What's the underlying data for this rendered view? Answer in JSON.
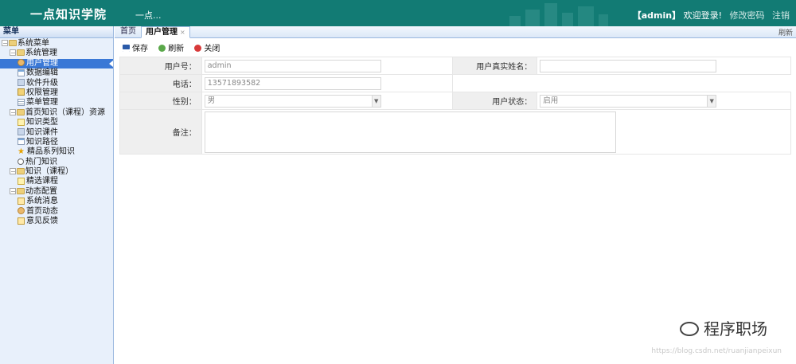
{
  "header": {
    "brand": "一点知识学院",
    "slogan": "一点...",
    "user": "【admin】",
    "welcome": "欢迎登录!",
    "change_password": "修改密码",
    "logout": "注销"
  },
  "sidebar": {
    "title": "菜单",
    "items": [
      {
        "label": "系统菜单",
        "level": 0,
        "type": "folder",
        "icon": "folder-icon"
      },
      {
        "label": "系统管理",
        "level": 1,
        "type": "folder",
        "icon": "folder-icon"
      },
      {
        "label": "用户管理",
        "level": 2,
        "type": "leaf",
        "icon": "user-icon",
        "selected": true
      },
      {
        "label": "数据编辑",
        "level": 2,
        "type": "leaf",
        "icon": "grid-icon"
      },
      {
        "label": "软件升级",
        "level": 2,
        "type": "leaf",
        "icon": "box-icon"
      },
      {
        "label": "权限管理",
        "level": 2,
        "type": "leaf",
        "icon": "lock-icon"
      },
      {
        "label": "菜单管理",
        "level": 2,
        "type": "leaf",
        "icon": "list-icon"
      },
      {
        "label": "首页知识（课程）资源",
        "level": 1,
        "type": "folder",
        "icon": "folder-icon"
      },
      {
        "label": "知识类型",
        "level": 2,
        "type": "leaf",
        "icon": "doc-icon"
      },
      {
        "label": "知识课件",
        "level": 2,
        "type": "leaf",
        "icon": "box-icon"
      },
      {
        "label": "知识路径",
        "level": 2,
        "type": "leaf",
        "icon": "grid-icon"
      },
      {
        "label": "精品系列知识",
        "level": 2,
        "type": "leaf",
        "icon": "star-icon"
      },
      {
        "label": "热门知识",
        "level": 2,
        "type": "leaf",
        "icon": "search-icon"
      },
      {
        "label": "知识（课程）",
        "level": 1,
        "type": "folder",
        "icon": "folder-icon"
      },
      {
        "label": "精选课程",
        "level": 2,
        "type": "leaf",
        "icon": "doc-icon"
      },
      {
        "label": "动态配置",
        "level": 1,
        "type": "folder",
        "icon": "folder-icon"
      },
      {
        "label": "系统消息",
        "level": 2,
        "type": "leaf",
        "icon": "mail-icon"
      },
      {
        "label": "首页动态",
        "level": 2,
        "type": "leaf",
        "icon": "user-icon"
      },
      {
        "label": "意见反馈",
        "level": 2,
        "type": "leaf",
        "icon": "mail-icon"
      }
    ]
  },
  "tabs": {
    "home": "首页",
    "active": "用户管理",
    "close": "×",
    "refresh": "刷新"
  },
  "toolbar": {
    "save": "保存",
    "refresh": "刷新",
    "close": "关闭"
  },
  "form": {
    "user_id_label": "用户号：",
    "user_id_value": "admin",
    "real_name_label": "用户真实姓名：",
    "real_name_value": "",
    "phone_label": "电话：",
    "phone_value": "13571893582",
    "gender_label": "性别：",
    "gender_value": "男",
    "status_label": "用户状态：",
    "status_value": "启用",
    "remark_label": "备注：",
    "remark_value": ""
  },
  "watermark": {
    "main": "程序职场",
    "url": "https://blog.csdn.net/ruanjianpeixun"
  },
  "colors": {
    "header_bg": "#127b74",
    "sidebar_bg": "#e8f0fb",
    "selected_bg": "#3a78d6"
  }
}
